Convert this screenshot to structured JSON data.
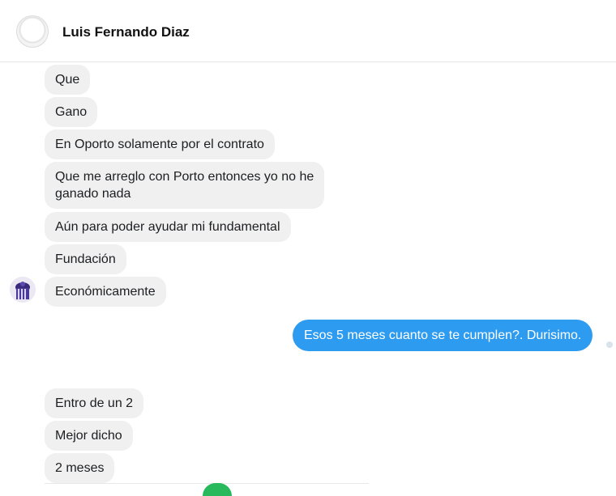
{
  "header": {
    "contact_name": "Luis Fernando Diaz",
    "avatar_icon": "default-profile-silhouette-icon"
  },
  "messages": [
    {
      "direction": "incoming",
      "text": "Que"
    },
    {
      "direction": "incoming",
      "text": "Gano"
    },
    {
      "direction": "incoming",
      "text": "En Oporto solamente por el contrato"
    },
    {
      "direction": "incoming",
      "text": "Que me arreglo con Porto entonces yo no he\nganado nada"
    },
    {
      "direction": "incoming",
      "text": "Aún para poder ayudar mi fundamental"
    },
    {
      "direction": "incoming",
      "text": "Fundación"
    },
    {
      "direction": "incoming",
      "text": "Económicamente"
    },
    {
      "direction": "outgoing",
      "text": "Esos 5 meses cuanto se te cumplen?. Durisimo."
    },
    {
      "direction": "incoming",
      "text": "Entro de un 2"
    },
    {
      "direction": "incoming",
      "text": "Mejor dicho"
    },
    {
      "direction": "incoming",
      "text": "2 meses"
    }
  ],
  "colors": {
    "incoming_bubble": "#f0f0f0",
    "outgoing_bubble": "#2d9bf0",
    "bottom_indicator": "#28b95c"
  },
  "contact_avatar_icon": "team-crest-icon"
}
